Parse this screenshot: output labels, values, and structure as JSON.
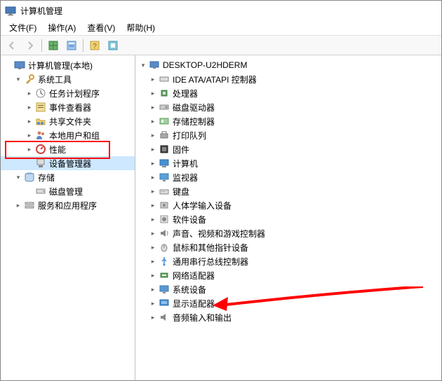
{
  "window_title": "计算机管理",
  "menubar": {
    "file": "文件(F)",
    "action": "操作(A)",
    "view": "查看(V)",
    "help": "帮助(H)"
  },
  "left_tree": {
    "root": "计算机管理(本地)",
    "system_tools": "系统工具",
    "task_scheduler": "任务计划程序",
    "event_viewer": "事件查看器",
    "shared_folders": "共享文件夹",
    "local_users": "本地用户和组",
    "performance": "性能",
    "device_manager": "设备管理器",
    "storage": "存储",
    "disk_management": "磁盘管理",
    "services": "服务和应用程序"
  },
  "right_tree": {
    "root": "DESKTOP-U2HDERM",
    "ide": "IDE ATA/ATAPI 控制器",
    "cpu": "处理器",
    "disk": "磁盘驱动器",
    "storage_ctrl": "存储控制器",
    "print": "打印队列",
    "firmware": "固件",
    "computer": "计算机",
    "monitor": "监视器",
    "keyboard": "键盘",
    "hid": "人体学输入设备",
    "software": "软件设备",
    "audio": "声音、视频和游戏控制器",
    "mouse": "鼠标和其他指针设备",
    "usb": "通用串行总线控制器",
    "network": "网络适配器",
    "system": "系统设备",
    "display": "显示适配器",
    "audio_io": "音频输入和输出"
  }
}
